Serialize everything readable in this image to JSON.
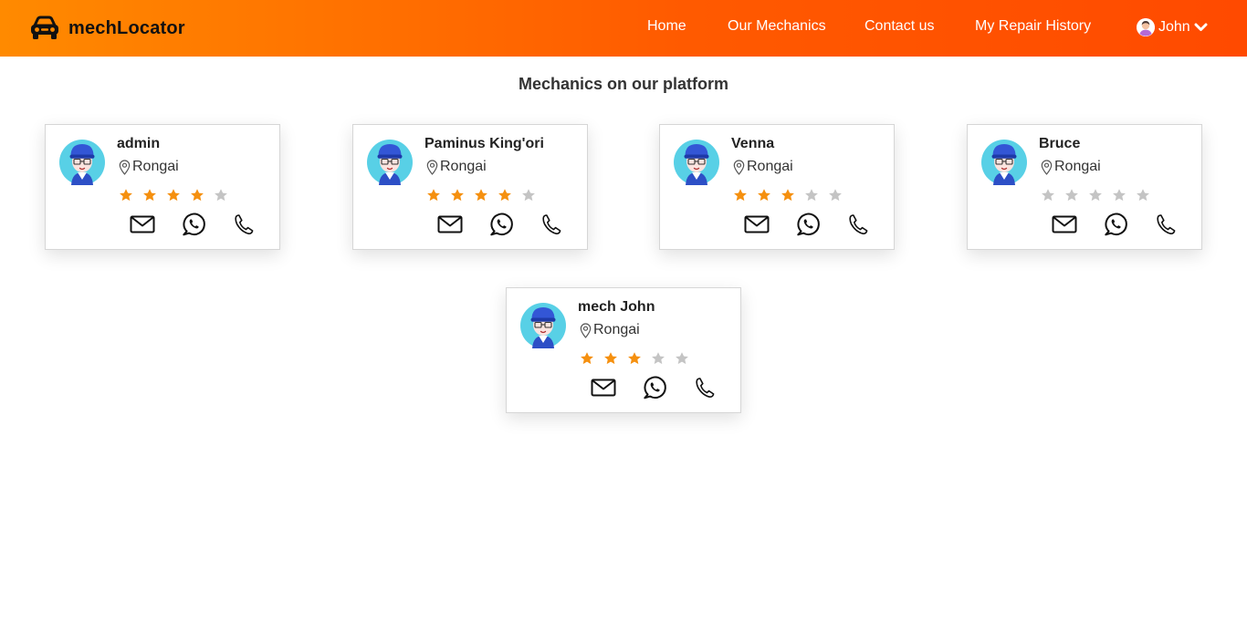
{
  "header": {
    "brand": "mechLocator",
    "nav": [
      "Home",
      "Our Mechanics",
      "Contact us",
      "My Repair History"
    ],
    "user": "John"
  },
  "page": {
    "title": "Mechanics on our platform"
  },
  "mechanics": [
    {
      "name": "admin",
      "location": "Rongai",
      "rating": 4
    },
    {
      "name": "Paminus King'ori",
      "location": "Rongai",
      "rating": 4
    },
    {
      "name": "Venna",
      "location": "Rongai",
      "rating": 3
    },
    {
      "name": "Bruce",
      "location": "Rongai",
      "rating": 0
    },
    {
      "name": "mech John",
      "location": "Rongai",
      "rating": 3
    }
  ],
  "colors": {
    "header_start": "#ff8a00",
    "header_end": "#ff4a00",
    "star_on": "#f5900f",
    "star_off": "#c4c4c4"
  },
  "icons": [
    "car-icon",
    "user-avatar-icon",
    "chevron-down-icon",
    "location-pin-icon",
    "star-icon",
    "mail-icon",
    "whatsapp-icon",
    "phone-icon"
  ]
}
